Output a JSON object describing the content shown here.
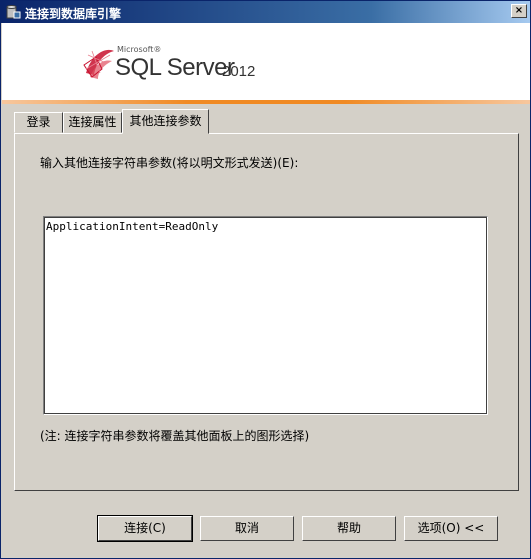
{
  "window": {
    "title": "连接到数据库引擎",
    "close_glyph": "×"
  },
  "banner": {
    "microsoft": "Microsoft®",
    "product": "SQL Server",
    "version": "2012"
  },
  "tabs": [
    {
      "label": "登录",
      "active": false
    },
    {
      "label": "连接属性",
      "active": false
    },
    {
      "label": "其他连接参数",
      "active": true
    }
  ],
  "panel": {
    "prompt_text": "输入其他连接字符串参数(将以明文形式发送)",
    "prompt_hotkey": "(E):",
    "params_value": "ApplicationIntent=ReadOnly",
    "note": "(注: 连接字符串参数将覆盖其他面板上的图形选择)"
  },
  "buttons": {
    "connect": "连接(C)",
    "cancel": "取消",
    "help": "帮助",
    "options": "选项(O) <<"
  }
}
